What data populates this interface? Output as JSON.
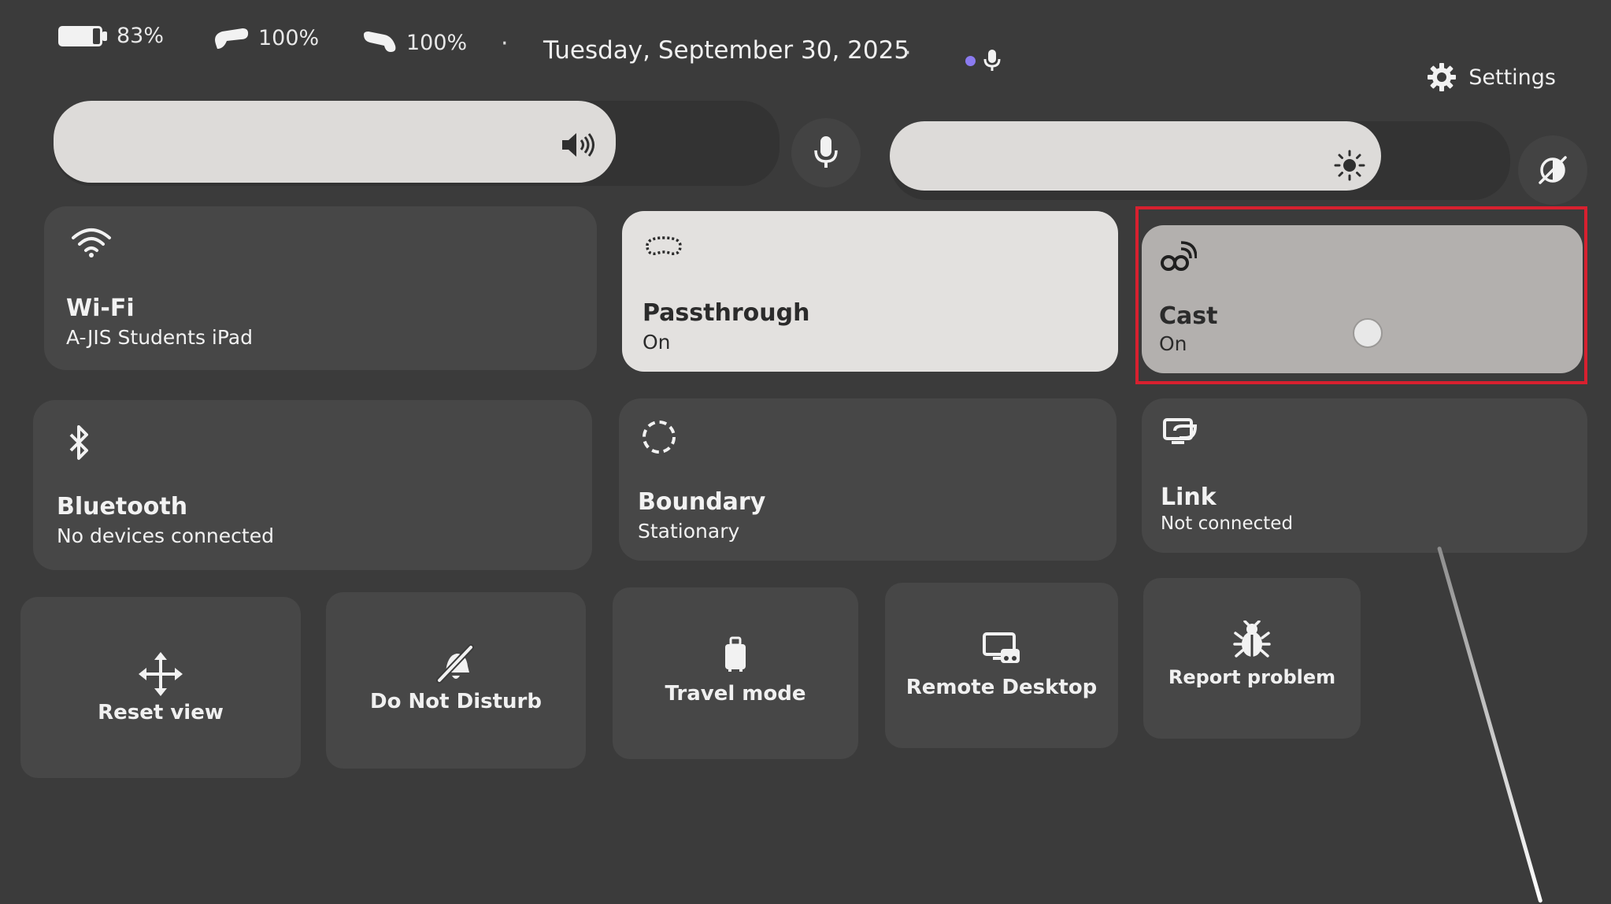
{
  "status": {
    "headset_battery": "83%",
    "controller_left_battery": "100%",
    "controller_right_battery": "100%",
    "separator": "·",
    "date": "Tuesday, September 30, 2025",
    "settings_label": "Settings",
    "mic_indicator_color": "#8b7bf0"
  },
  "sliders": {
    "volume_level": 0.78,
    "brightness_level": 0.8
  },
  "tiles": {
    "wifi": {
      "title": "Wi-Fi",
      "subtitle": "A-JIS Students iPad"
    },
    "passthrough": {
      "title": "Passthrough",
      "subtitle": "On"
    },
    "cast": {
      "title": "Cast",
      "subtitle": "On"
    },
    "bluetooth": {
      "title": "Bluetooth",
      "subtitle": "No devices connected"
    },
    "boundary": {
      "title": "Boundary",
      "subtitle": "Stationary"
    },
    "link": {
      "title": "Link",
      "subtitle": "Not connected"
    }
  },
  "actions": {
    "reset_view": "Reset view",
    "do_not_disturb": "Do Not Disturb",
    "travel_mode": "Travel mode",
    "remote_desktop": "Remote Desktop",
    "report_problem": "Report problem"
  },
  "colors": {
    "background": "#3b3b3b",
    "tile": "#474747",
    "tile_active": "#e3e1df",
    "tile_cast": "#b3b0ae",
    "highlight": "#d8202f"
  }
}
